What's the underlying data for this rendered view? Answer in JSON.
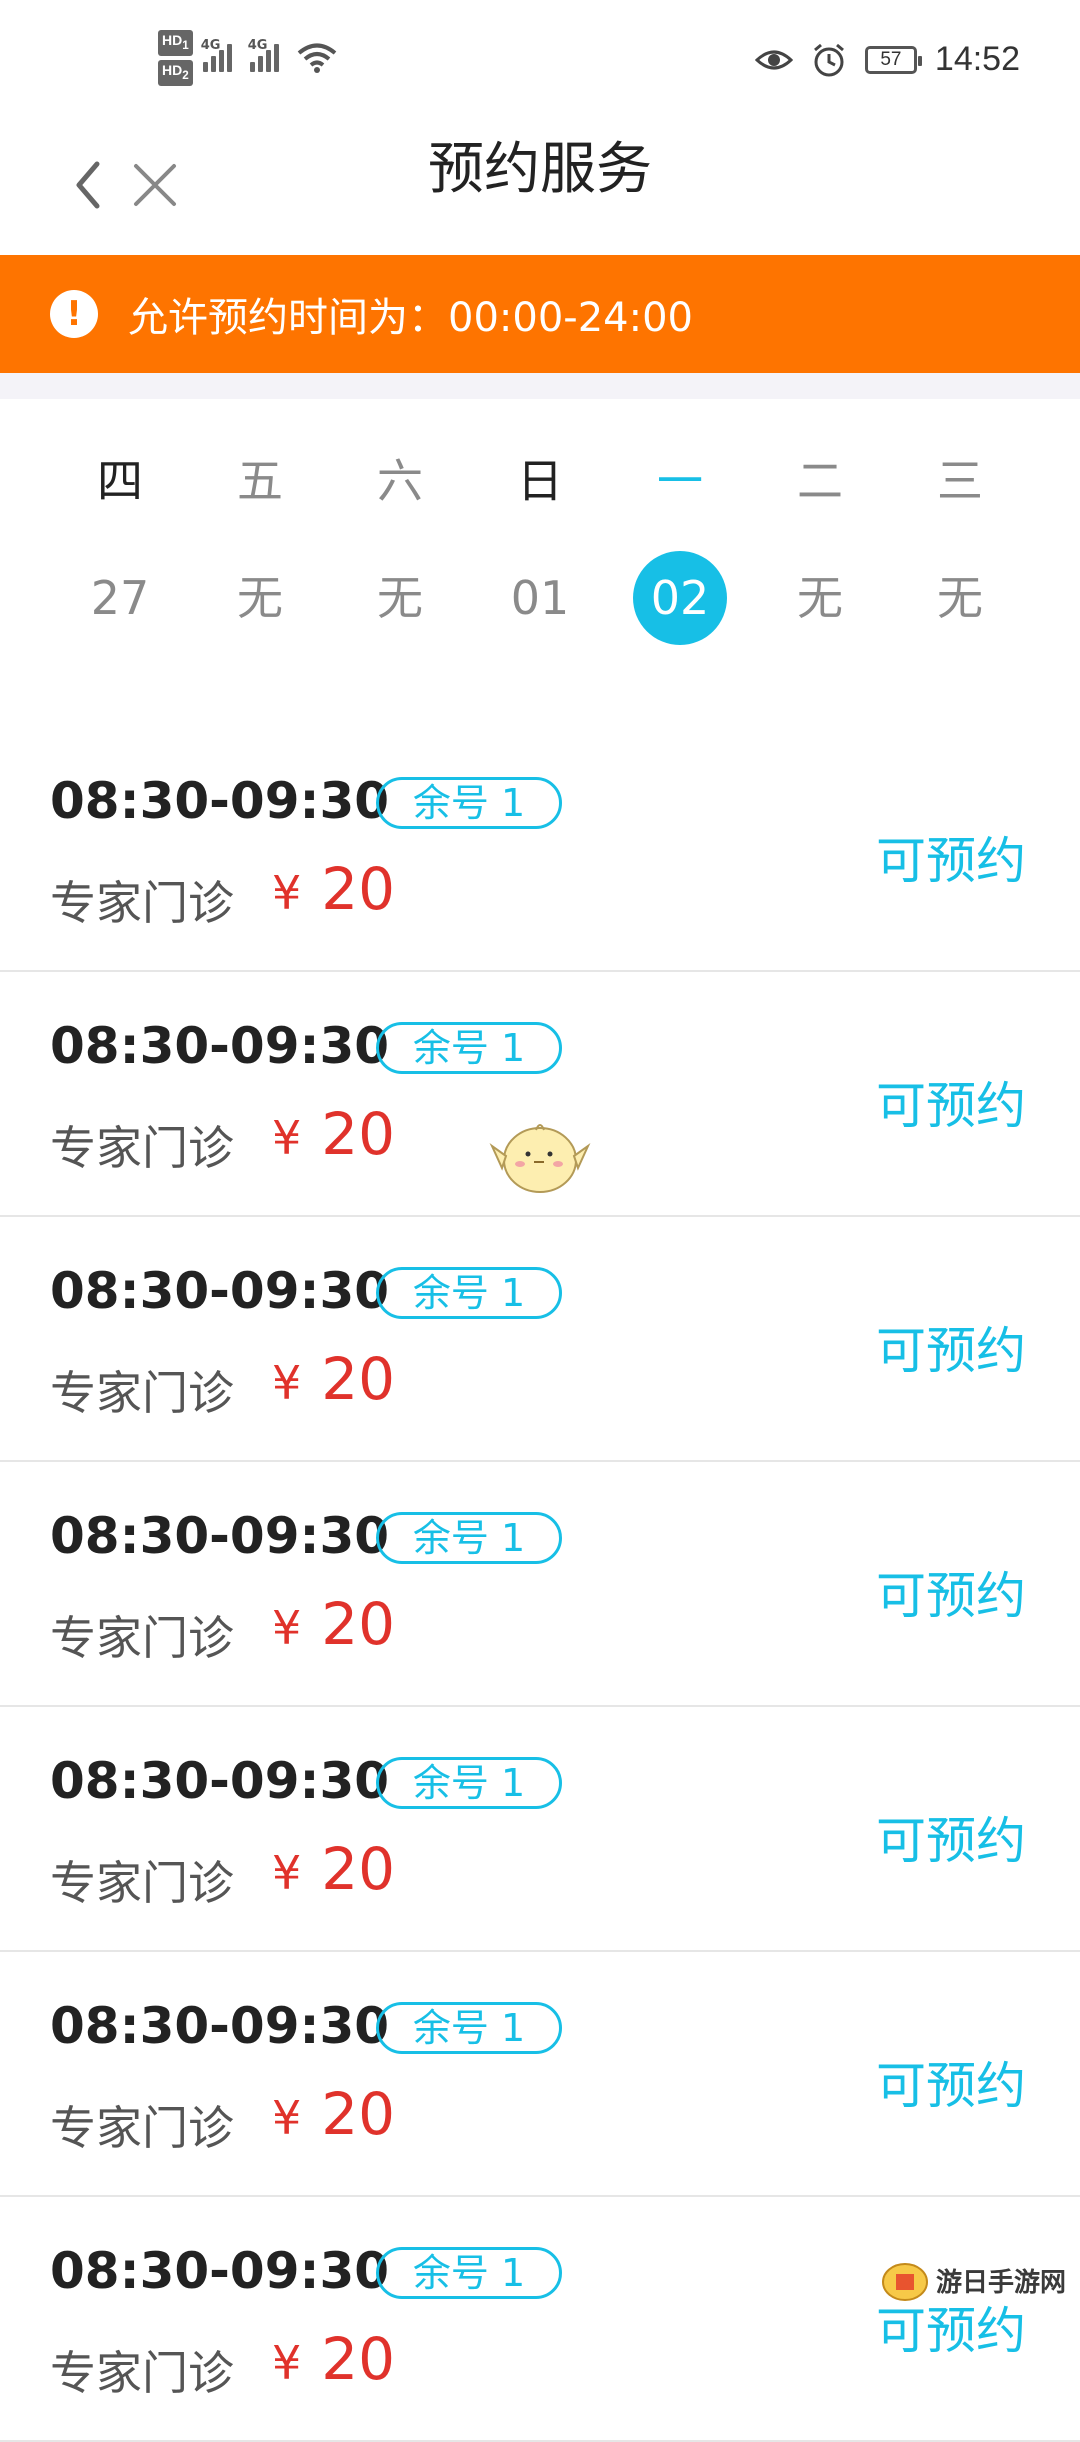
{
  "status_bar": {
    "hd1": "HD",
    "hd1_sub": "1",
    "hd2": "HD",
    "hd2_sub": "2",
    "net1": "4G",
    "net2": "4G",
    "battery": "57",
    "time": "14:52"
  },
  "header": {
    "title": "预约服务"
  },
  "banner": {
    "icon": "!",
    "text": "允许预约时间为：00:00-24:00",
    "color": "#fe7400"
  },
  "calendar": {
    "weekdays": [
      "四",
      "五",
      "六",
      "日",
      "一",
      "二",
      "三"
    ],
    "dates": [
      "27",
      "无",
      "无",
      "01",
      "02",
      "无",
      "无"
    ],
    "selected_index": 4,
    "accent": "#17bfe6"
  },
  "slots": [
    {
      "time": "08:30-09:30",
      "badge": "余号 1",
      "type": "专家门诊",
      "currency": "¥",
      "price": "20",
      "action": "可预约"
    },
    {
      "time": "08:30-09:30",
      "badge": "余号 1",
      "type": "专家门诊",
      "currency": "¥",
      "price": "20",
      "action": "可预约"
    },
    {
      "time": "08:30-09:30",
      "badge": "余号 1",
      "type": "专家门诊",
      "currency": "¥",
      "price": "20",
      "action": "可预约"
    },
    {
      "time": "08:30-09:30",
      "badge": "余号 1",
      "type": "专家门诊",
      "currency": "¥",
      "price": "20",
      "action": "可预约"
    },
    {
      "time": "08:30-09:30",
      "badge": "余号 1",
      "type": "专家门诊",
      "currency": "¥",
      "price": "20",
      "action": "可预约"
    },
    {
      "time": "08:30-09:30",
      "badge": "余号 1",
      "type": "专家门诊",
      "currency": "¥",
      "price": "20",
      "action": "可预约"
    },
    {
      "time": "08:30-09:30",
      "badge": "余号 1",
      "type": "专家门诊",
      "currency": "¥",
      "price": "20",
      "action": "可预约"
    }
  ],
  "watermark": {
    "text": "游日手游网"
  }
}
